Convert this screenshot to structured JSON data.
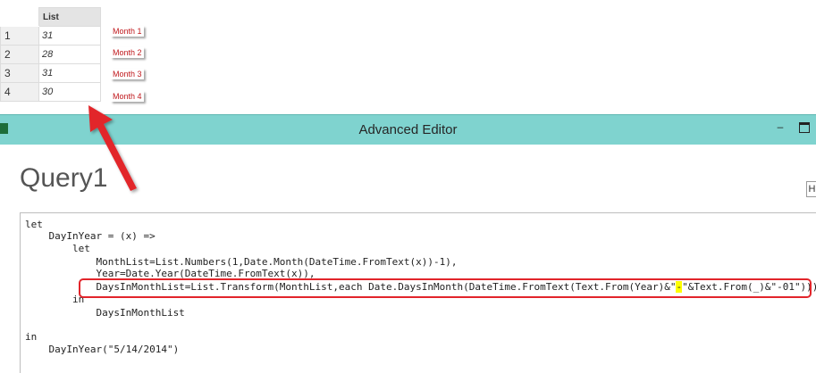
{
  "list_preview": {
    "column_header": "List",
    "rows": [
      {
        "num": "1",
        "value": "31",
        "annotation": "Month 1"
      },
      {
        "num": "2",
        "value": "28",
        "annotation": "Month 2"
      },
      {
        "num": "3",
        "value": "31",
        "annotation": "Month 3"
      },
      {
        "num": "4",
        "value": "30",
        "annotation": "Month 4"
      }
    ]
  },
  "window": {
    "title": "Advanced Editor",
    "app_icon": "excel-icon",
    "minimize_glyph": "–"
  },
  "query": {
    "name": "Query1",
    "side_tab": "H"
  },
  "code": {
    "line1": "let",
    "line2": "    DayInYear = (x) =>",
    "line3": "        let",
    "line4": "            MonthList=List.Numbers(1,Date.Month(DateTime.FromText(x))-1),",
    "line5": "            Year=Date.Year(DateTime.FromText(x)),",
    "line6_before": "            DaysInMonthList=List.Transform(MonthList,each Date.DaysInMonth(DateTime.FromText(Text.From(Year)&\"",
    "line6_highlight": "-",
    "line6_after": "\"&Text.From(_)&\"-01\")))",
    "line7": "        in",
    "line8": "            DaysInMonthList",
    "line9": "",
    "line10": "in",
    "line11": "    DayInYear(\"5/14/2014\")"
  },
  "colors": {
    "titlebar": "#7fd3cf",
    "annotation_red": "#e2252b",
    "highlight": "#ffff00"
  }
}
